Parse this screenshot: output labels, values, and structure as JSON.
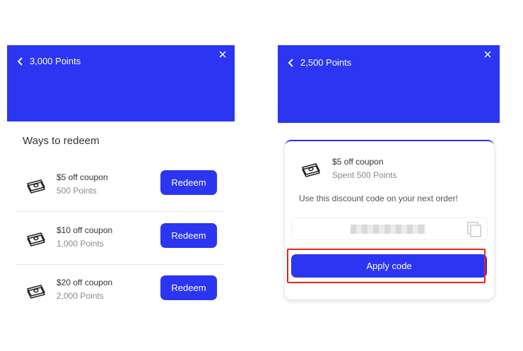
{
  "left_panel": {
    "points_label": "3,000 Points",
    "ways_title": "Ways to redeem",
    "items": [
      {
        "title": "$5 off coupon",
        "points": "500 Points",
        "button": "Redeem"
      },
      {
        "title": "$10 off coupon",
        "points": "1,000 Points",
        "button": "Redeem"
      },
      {
        "title": "$20 off coupon",
        "points": "2,000 Points",
        "button": "Redeem"
      }
    ]
  },
  "right_panel": {
    "points_label": "2,500 Points",
    "coupon_title": "$5 off coupon",
    "coupon_spent": "Spent 500 Points",
    "instruction": "Use this discount code on your next order!",
    "apply_button": "Apply code"
  },
  "icons": [
    "back-chevron-icon",
    "close-icon",
    "cash-icon",
    "copy-icon"
  ],
  "colors": {
    "brand": "#2b35f2",
    "highlight": "#ee1f1f"
  }
}
